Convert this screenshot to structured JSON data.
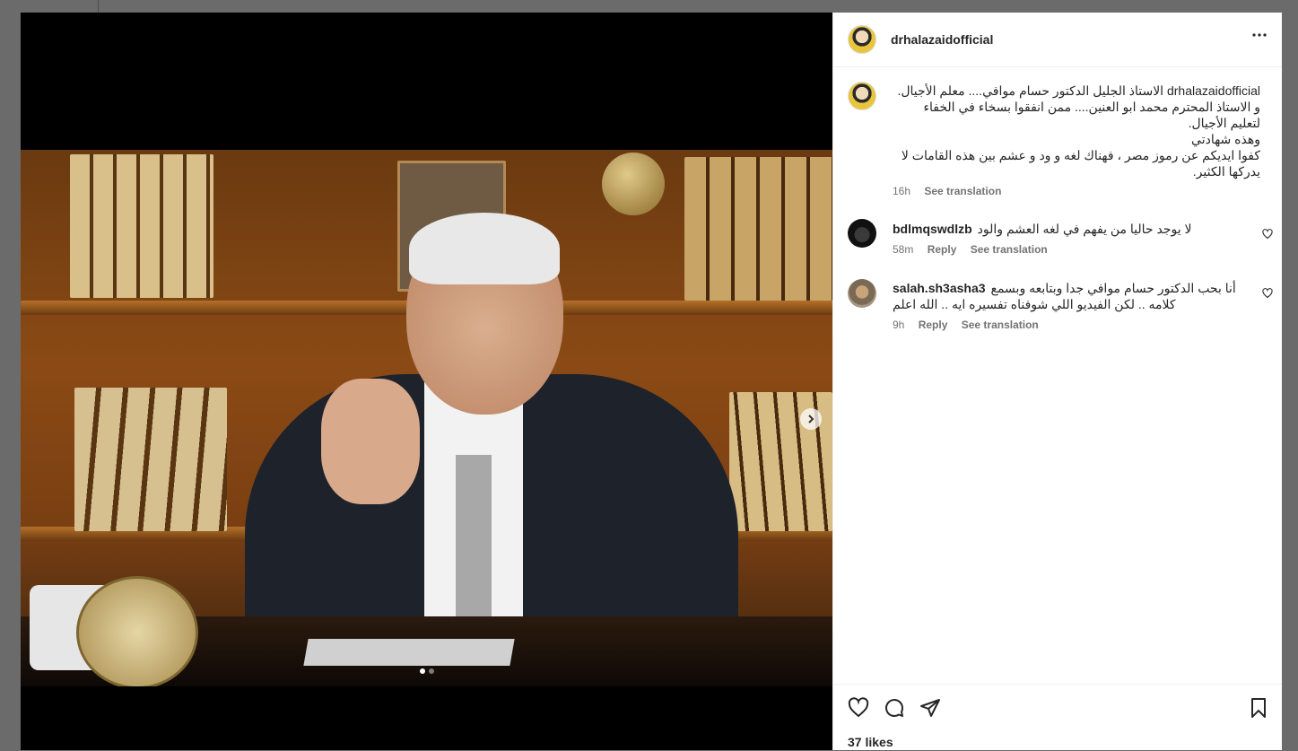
{
  "post": {
    "username": "drhalazaidofficial",
    "more_icon": "more-horizontal-icon",
    "caption_lines": [
      "drhalazaidofficial الاستاذ الجليل الدكتور حسام موافي.... معلم الأجيال.",
      "و الاستاذ المحترم محمد ابو العنين.... ممن انفقوا بسخاء في الخفاء",
      "لتعليم الأجيال.",
      "وهذه شهادتي",
      "كفوا ايديكم عن رموز مصر ، فهناك لغه و ود و عشم بين هذه القامات لا",
      "يدركها الكثير."
    ],
    "caption_time": "16h",
    "see_translation": "See translation"
  },
  "comments": [
    {
      "username": "bdlmqswdlzb",
      "text": "لا يوجد حاليا من يفهم في لغه العشم والود",
      "time": "58m",
      "reply": "Reply",
      "translate": "See translation"
    },
    {
      "username": "salah.sh3asha3",
      "text_line1": "أنا بحب الدكتور حسام موافي جدا وبتابعه وبسمع",
      "text_line2": "كلامه .. لكن الفيديو اللي شوفناه تفسيره ايه .. الله اعلم",
      "time": "9h",
      "reply": "Reply",
      "translate": "See translation"
    }
  ],
  "actions": {
    "likes": "37 likes"
  },
  "carousel": {
    "slide_count": 2,
    "active_index": 0
  },
  "colors": {
    "text": "#262626",
    "muted": "#737373",
    "border": "#efefef"
  }
}
